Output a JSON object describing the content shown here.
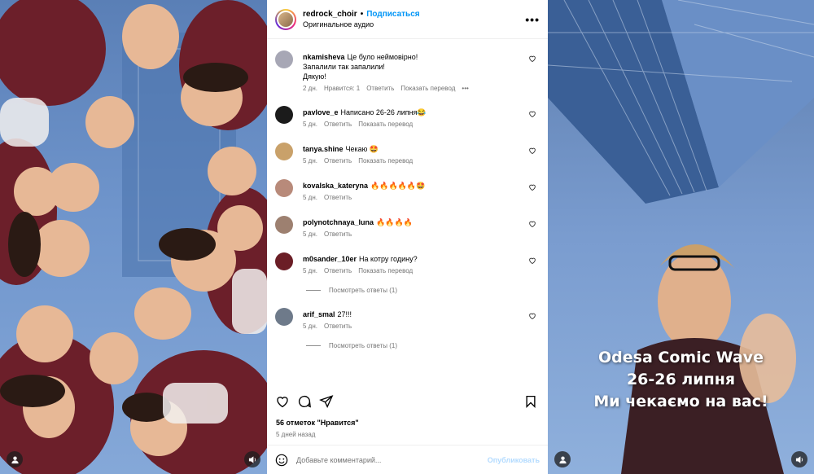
{
  "post": {
    "username": "redrock_choir",
    "follow_label": "Подписаться",
    "audio_label": "Оригинальное аудио",
    "more_label": "•••"
  },
  "comments": [
    {
      "user": "nkamisheva",
      "text": "Це було неймовірно!\nЗапалили так запалили!\nДякую!",
      "time": "2 дн.",
      "likes": "Нравится: 1",
      "reply": "Ответить",
      "translate": "Показать перевод",
      "more": "•••",
      "avatar_color": "#a7a7b5"
    },
    {
      "user": "pavlove_e",
      "text": "Написано 26-26 липня😂",
      "time": "5 дн.",
      "reply": "Ответить",
      "translate": "Показать перевод",
      "avatar_color": "#1b1b1b"
    },
    {
      "user": "tanya.shine",
      "text": "Чекаю 🤩",
      "time": "5 дн.",
      "reply": "Ответить",
      "translate": "Показать перевод",
      "avatar_color": "#c9a16a"
    },
    {
      "user": "kovalska_kateryna",
      "text": "🔥🔥🔥🔥🔥🤩",
      "time": "5 дн.",
      "reply": "Ответить",
      "avatar_color": "#b88a7a"
    },
    {
      "user": "polynotchnaya_luna",
      "text": "🔥🔥🔥🔥",
      "time": "5 дн.",
      "reply": "Ответить",
      "avatar_color": "#9d8070"
    },
    {
      "user": "m0sander_10er",
      "text": "На котру годину?",
      "time": "5 дн.",
      "reply": "Ответить",
      "translate": "Показать перевод",
      "avatar_color": "#6b1e26"
    },
    {
      "user": "arif_smal",
      "text": "27!!!",
      "time": "5 дн.",
      "reply": "Ответить",
      "avatar_color": "#6e7a8a"
    }
  ],
  "replies_labels": [
    "Посмотреть ответы (1)",
    "Посмотреть ответы (1)"
  ],
  "likes_label": "56 отметок \"Нравится\"",
  "posted_ago": "5 дней назад",
  "comment_placeholder": "Добавьте комментарий...",
  "publish_label": "Опубликовать",
  "right_video": {
    "line1": "Odesa Comic Wave",
    "line2": "26-26 липня",
    "line3": "Ми чекаємо на вас!"
  },
  "colors": {
    "accent": "#0095f6",
    "publish_disabled": "#b3dbff"
  },
  "icons": [
    "user-icon",
    "volume-icon",
    "heart-icon",
    "comment-icon",
    "share-icon",
    "bookmark-icon",
    "emoji-icon",
    "more-icon"
  ]
}
